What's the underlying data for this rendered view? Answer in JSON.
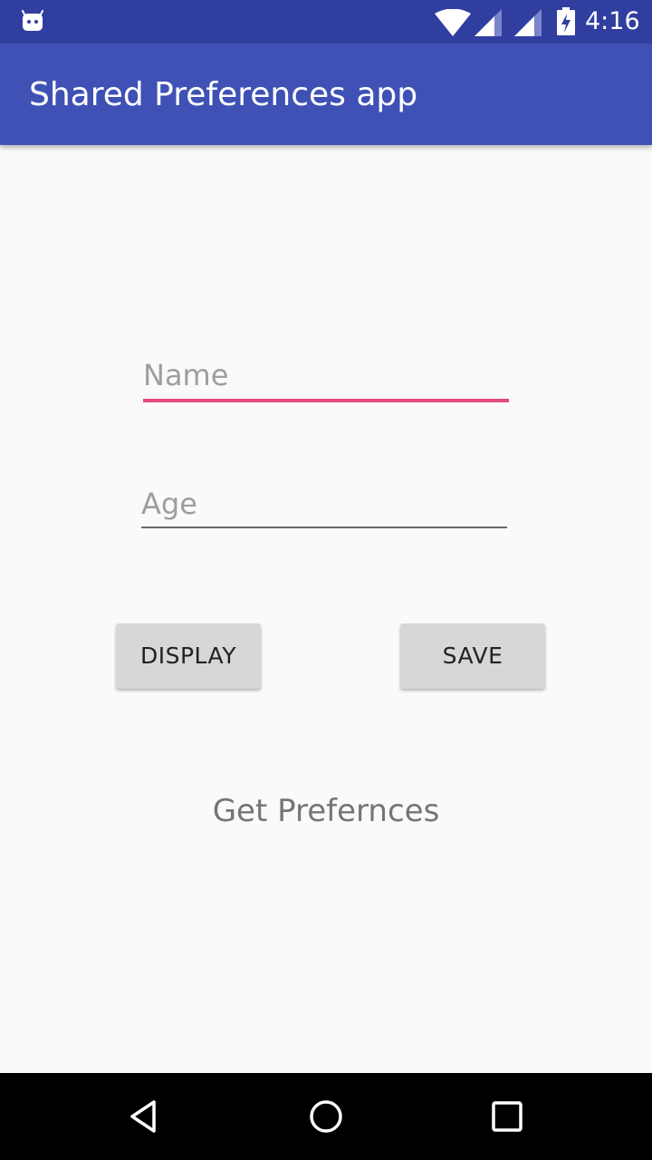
{
  "status_bar": {
    "time": "4:16",
    "icons": [
      "android-debug-icon",
      "wifi-icon",
      "cell-signal-icon",
      "cell-signal-icon",
      "battery-charging-icon"
    ]
  },
  "app_bar": {
    "title": "Shared Preferences app"
  },
  "form": {
    "name_placeholder": "Name",
    "name_value": "",
    "age_placeholder": "Age",
    "age_value": ""
  },
  "buttons": {
    "display_label": "DISPLAY",
    "save_label": "SAVE"
  },
  "result": {
    "text": "Get Prefernces"
  },
  "nav_bar": {
    "icons": [
      "back-icon",
      "home-icon",
      "recents-icon"
    ]
  },
  "colors": {
    "status_bar": "#303f9f",
    "app_bar": "#3f51b5",
    "accent": "#e64a84",
    "background": "#fafafa",
    "button": "#d6d7d7"
  }
}
